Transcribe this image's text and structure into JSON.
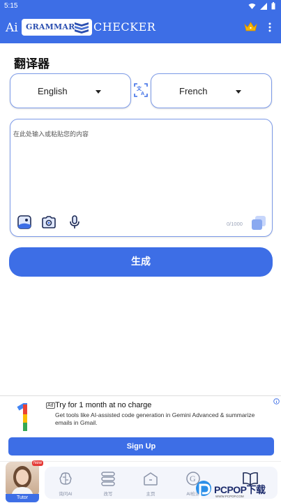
{
  "status_bar": {
    "time": "5:15"
  },
  "app_bar": {
    "logo_prefix": "Ai",
    "logo_middle": "GRAMMAR",
    "logo_suffix": "CHECKER"
  },
  "page": {
    "title": "翻译器"
  },
  "languages": {
    "source": "English",
    "target": "French"
  },
  "input": {
    "placeholder": "在此处输入或粘贴您的内容",
    "value": "",
    "char_count": "0/1000"
  },
  "generate_label": "生成",
  "ad": {
    "badge": "Ad",
    "title": "Try for 1 month at no charge",
    "description": "Get tools like AI-assisted code generation in Gemini Advanced & summarize emails in Gmail.",
    "cta": "Sign Up"
  },
  "bottom_nav": {
    "tutor_badge": "New",
    "tutor_label": "Tutor",
    "items": [
      {
        "label": "询问AI",
        "icon": "ai-brain-icon"
      },
      {
        "label": "改写",
        "icon": "rewrite-icon"
      },
      {
        "label": "主页",
        "icon": "home-icon"
      },
      {
        "label": "AI检测",
        "icon": "ai-detector-icon"
      },
      {
        "label": "",
        "icon": "book-icon"
      }
    ]
  },
  "watermark": {
    "brand": "PCPOP下载",
    "sub": "WWW.PCPOP.COM"
  },
  "colors": {
    "primary": "#3d6ee6",
    "border": "#7c9ae8"
  }
}
